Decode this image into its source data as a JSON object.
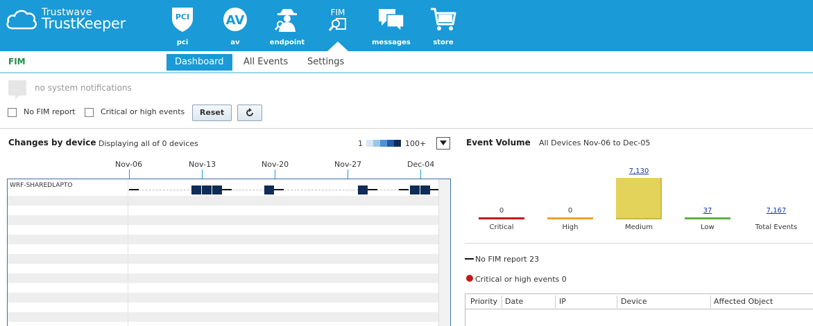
{
  "brand": {
    "line1": "Trustwave",
    "line2": "TrustKeeper"
  },
  "nav": [
    {
      "label": "pci",
      "icon": "shield-pci-icon",
      "badge": "PCI"
    },
    {
      "label": "av",
      "icon": "av-circle-icon",
      "badge": "AV"
    },
    {
      "label": "endpoint",
      "icon": "spy-icon"
    },
    {
      "label": "",
      "icon": "fim-icon",
      "badge": "FIM",
      "active": true
    },
    {
      "label": "messages",
      "icon": "chat-bubbles-icon"
    },
    {
      "label": "store",
      "icon": "cart-icon"
    }
  ],
  "section": {
    "title": "FIM"
  },
  "tabs": [
    {
      "label": "Dashboard",
      "active": true
    },
    {
      "label": "All Events"
    },
    {
      "label": "Settings"
    }
  ],
  "notifications": {
    "text": "no system notifications"
  },
  "filters": {
    "no_fim_report": "No FIM report",
    "critical_high": "Critical or high events",
    "reset_label": "Reset"
  },
  "changes": {
    "title": "Changes by device",
    "subtitle": "Displaying all of 0 devices",
    "legend_min": "1",
    "legend_max": "100+",
    "legend_colors": [
      "#d6e8f5",
      "#9bc7e6",
      "#4f93cf",
      "#1e5fa6",
      "#0f2c57"
    ],
    "dates": [
      "Nov-06",
      "Nov-13",
      "Nov-20",
      "Nov-27",
      "Dec-04"
    ],
    "devices": [
      {
        "name": "WRF-SHAREDLAPTO"
      }
    ]
  },
  "volume": {
    "title": "Event Volume",
    "subtitle": "All Devices Nov-06 to Dec-05"
  },
  "chart_data": {
    "type": "bar",
    "categories": [
      "Critical",
      "High",
      "Medium",
      "Low",
      "Total Events"
    ],
    "values": [
      0,
      0,
      7130,
      37,
      7167
    ],
    "value_labels": [
      "0",
      "0",
      "7,130",
      "37",
      "7,167"
    ],
    "colors": [
      "#c11b17",
      "#f2a02f",
      "#e3d35a",
      "#5db043",
      "#1a35a8"
    ],
    "ylim": [
      0,
      7130
    ]
  },
  "legend": {
    "no_fim": "No FIM report 23",
    "critical": "Critical or high events 0"
  },
  "table": {
    "columns": [
      "Priority",
      "Date",
      "IP",
      "Device",
      "Affected Object"
    ]
  }
}
